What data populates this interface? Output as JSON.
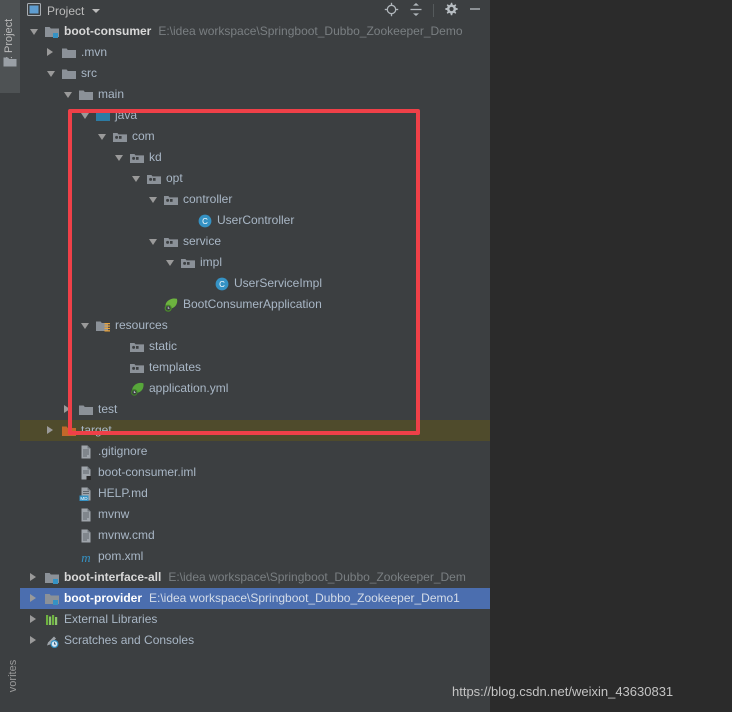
{
  "tool_strip": {
    "tab_label": "1: Project",
    "tab_icon": "project-tool-window-icon",
    "bottom_label": "vorites",
    "bottom_icon": "favorites-icon"
  },
  "header": {
    "title": "Project",
    "view_icon": "project-view-icon",
    "dropdown_icon": "chevron-down-icon",
    "actions": [
      {
        "name": "scroll-from-source-icon",
        "tooltip": "Select Opened File"
      },
      {
        "name": "collapse-all-icon",
        "tooltip": "Collapse All"
      },
      {
        "name": "settings-gear-icon",
        "tooltip": "Settings"
      },
      {
        "name": "hide-icon",
        "tooltip": "Hide"
      }
    ]
  },
  "tree": {
    "rows": [
      {
        "label": "boot-consumer",
        "path": "E:\\idea workspace\\Springboot_Dubbo_Zookeeper_Demo",
        "depth": 0,
        "arrow": "expanded",
        "icon": "module-folder-icon",
        "bold": true,
        "state": "normal"
      },
      {
        "label": ".mvn",
        "path": "",
        "depth": 1,
        "arrow": "collapsed",
        "icon": "folder-icon",
        "bold": false,
        "state": "normal"
      },
      {
        "label": "src",
        "path": "",
        "depth": 1,
        "arrow": "expanded",
        "icon": "folder-icon",
        "bold": false,
        "state": "normal"
      },
      {
        "label": "main",
        "path": "",
        "depth": 2,
        "arrow": "expanded",
        "icon": "folder-icon",
        "bold": false,
        "state": "normal"
      },
      {
        "label": "java",
        "path": "",
        "depth": 3,
        "arrow": "expanded",
        "icon": "source-root-folder-icon",
        "bold": false,
        "state": "normal"
      },
      {
        "label": "com",
        "path": "",
        "depth": 4,
        "arrow": "expanded",
        "icon": "package-icon",
        "bold": false,
        "state": "normal"
      },
      {
        "label": "kd",
        "path": "",
        "depth": 5,
        "arrow": "expanded",
        "icon": "package-icon",
        "bold": false,
        "state": "normal"
      },
      {
        "label": "opt",
        "path": "",
        "depth": 6,
        "arrow": "expanded",
        "icon": "package-icon",
        "bold": false,
        "state": "normal"
      },
      {
        "label": "controller",
        "path": "",
        "depth": 7,
        "arrow": "expanded",
        "icon": "package-icon",
        "bold": false,
        "state": "normal"
      },
      {
        "label": "UserController",
        "path": "",
        "depth": 9,
        "arrow": "none",
        "icon": "java-class-icon",
        "bold": false,
        "state": "normal"
      },
      {
        "label": "service",
        "path": "",
        "depth": 7,
        "arrow": "expanded",
        "icon": "package-icon",
        "bold": false,
        "state": "normal"
      },
      {
        "label": "impl",
        "path": "",
        "depth": 8,
        "arrow": "expanded",
        "icon": "package-icon",
        "bold": false,
        "state": "normal"
      },
      {
        "label": "UserServiceImpl",
        "path": "",
        "depth": 10,
        "arrow": "none",
        "icon": "java-class-icon",
        "bold": false,
        "state": "normal"
      },
      {
        "label": "BootConsumerApplication",
        "path": "",
        "depth": 7,
        "arrow": "none",
        "icon": "spring-boot-class-icon",
        "bold": false,
        "state": "normal"
      },
      {
        "label": "resources",
        "path": "",
        "depth": 3,
        "arrow": "expanded",
        "icon": "resource-root-folder-icon",
        "bold": false,
        "state": "normal"
      },
      {
        "label": "static",
        "path": "",
        "depth": 5,
        "arrow": "none",
        "icon": "package-icon",
        "bold": false,
        "state": "normal"
      },
      {
        "label": "templates",
        "path": "",
        "depth": 5,
        "arrow": "none",
        "icon": "package-icon",
        "bold": false,
        "state": "normal"
      },
      {
        "label": "application.yml",
        "path": "",
        "depth": 5,
        "arrow": "none",
        "icon": "spring-yaml-icon",
        "bold": false,
        "state": "normal"
      },
      {
        "label": "test",
        "path": "",
        "depth": 2,
        "arrow": "collapsed",
        "icon": "folder-icon",
        "bold": false,
        "state": "normal"
      },
      {
        "label": "target",
        "path": "",
        "depth": 1,
        "arrow": "collapsed",
        "icon": "excluded-folder-icon",
        "bold": false,
        "state": "excluded"
      },
      {
        "label": ".gitignore",
        "path": "",
        "depth": 2,
        "arrow": "none",
        "icon": "text-file-icon",
        "bold": false,
        "state": "normal"
      },
      {
        "label": "boot-consumer.iml",
        "path": "",
        "depth": 2,
        "arrow": "none",
        "icon": "iml-file-icon",
        "bold": false,
        "state": "normal"
      },
      {
        "label": "HELP.md",
        "path": "",
        "depth": 2,
        "arrow": "none",
        "icon": "markdown-file-icon",
        "bold": false,
        "state": "normal"
      },
      {
        "label": "mvnw",
        "path": "",
        "depth": 2,
        "arrow": "none",
        "icon": "text-file-icon",
        "bold": false,
        "state": "normal"
      },
      {
        "label": "mvnw.cmd",
        "path": "",
        "depth": 2,
        "arrow": "none",
        "icon": "text-file-icon",
        "bold": false,
        "state": "normal"
      },
      {
        "label": "pom.xml",
        "path": "",
        "depth": 2,
        "arrow": "none",
        "icon": "maven-pom-icon",
        "bold": false,
        "state": "normal"
      },
      {
        "label": "boot-interface-all",
        "path": "E:\\idea workspace\\Springboot_Dubbo_Zookeeper_Dem",
        "depth": 0,
        "arrow": "collapsed",
        "icon": "module-folder-icon",
        "bold": true,
        "state": "normal"
      },
      {
        "label": "boot-provider",
        "path": "E:\\idea workspace\\Springboot_Dubbo_Zookeeper_Demo1",
        "depth": 0,
        "arrow": "collapsed",
        "icon": "module-folder-icon",
        "bold": true,
        "state": "selected"
      },
      {
        "label": "External Libraries",
        "path": "",
        "depth": 0,
        "arrow": "collapsed",
        "icon": "external-libraries-icon",
        "bold": false,
        "state": "normal"
      },
      {
        "label": "Scratches and Consoles",
        "path": "",
        "depth": 0,
        "arrow": "collapsed",
        "icon": "scratches-icon",
        "bold": false,
        "state": "normal"
      }
    ]
  },
  "annotation": {
    "type": "red-rectangle-highlight"
  },
  "watermark": {
    "text": "https://blog.csdn.net/weixin_43630831"
  },
  "colors": {
    "panel_bg": "#3c3f41",
    "editor_bg": "#2b2b2b",
    "selection_blue": "#4b6eaf",
    "excluded_olive": "#4f4b2c",
    "annotation_red": "#ef4048",
    "text": "#a9b7c6",
    "class_icon": "#3592c4",
    "source_root": "#2c7ba3"
  }
}
